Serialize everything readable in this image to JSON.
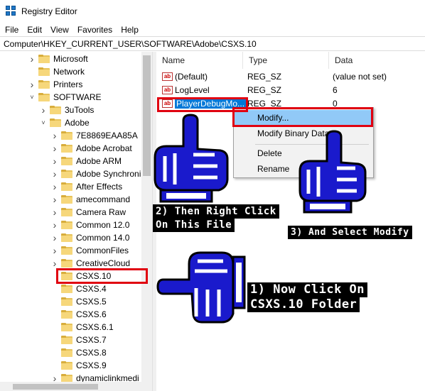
{
  "window": {
    "title": "Registry Editor"
  },
  "menubar": [
    "File",
    "Edit",
    "View",
    "Favorites",
    "Help"
  ],
  "address": "Computer\\HKEY_CURRENT_USER\\SOFTWARE\\Adobe\\CSXS.10",
  "tree": [
    {
      "label": "Microsoft",
      "chevron": ">"
    },
    {
      "label": "Network",
      "chevron": ""
    },
    {
      "label": "Printers",
      "chevron": ">"
    },
    {
      "label": "SOFTWARE",
      "chevron": "v"
    },
    {
      "label": "3uTools",
      "chevron": ">"
    },
    {
      "label": "Adobe",
      "chevron": "v"
    },
    {
      "label": "7E8869EAA85A",
      "chevron": ">"
    },
    {
      "label": "Adobe Acrobat",
      "chevron": ">"
    },
    {
      "label": "Adobe ARM",
      "chevron": ">"
    },
    {
      "label": "Adobe Synchroni",
      "chevron": ">"
    },
    {
      "label": "After Effects",
      "chevron": ">"
    },
    {
      "label": "amecommand",
      "chevron": ">"
    },
    {
      "label": "Camera Raw",
      "chevron": ">"
    },
    {
      "label": "Common 12.0",
      "chevron": ">"
    },
    {
      "label": "Common 14.0",
      "chevron": ">"
    },
    {
      "label": "CommonFiles",
      "chevron": ">"
    },
    {
      "label": "CreativeCloud",
      "chevron": ">"
    },
    {
      "label": "CSXS.10",
      "chevron": ""
    },
    {
      "label": "CSXS.4",
      "chevron": ""
    },
    {
      "label": "CSXS.5",
      "chevron": ""
    },
    {
      "label": "CSXS.6",
      "chevron": ""
    },
    {
      "label": "CSXS.6.1",
      "chevron": ""
    },
    {
      "label": "CSXS.7",
      "chevron": ""
    },
    {
      "label": "CSXS.8",
      "chevron": ""
    },
    {
      "label": "CSXS.9",
      "chevron": ""
    },
    {
      "label": "dynamiclinkmedi",
      "chevron": ">"
    }
  ],
  "columns": {
    "name": "Name",
    "type": "Type",
    "data": "Data"
  },
  "values": [
    {
      "name": "(Default)",
      "type": "REG_SZ",
      "data": "(value not set)",
      "icon": "ab-icon"
    },
    {
      "name": "LogLevel",
      "type": "REG_SZ",
      "data": "6",
      "icon": "ab-icon"
    },
    {
      "name": "PlayerDebugMo...",
      "type": "REG_SZ",
      "data": "0",
      "icon": "ab-icon"
    }
  ],
  "context_menu": {
    "items": [
      "Modify...",
      "Modify Binary Data...",
      "Delete",
      "Rename"
    ],
    "highlighted": "Modify..."
  },
  "annotations": {
    "step1_line1": "1) Now Click On",
    "step1_line2": "CSXS.10 Folder",
    "step2_line1": "2) Then Right Click",
    "step2_line2": "On This File",
    "step3": "3) And Select Modify"
  },
  "colors": {
    "highlight_box": "#e00010",
    "hand": "#1a1acc",
    "selection": "#0078d7",
    "menu_highlight": "#91c9f7"
  }
}
